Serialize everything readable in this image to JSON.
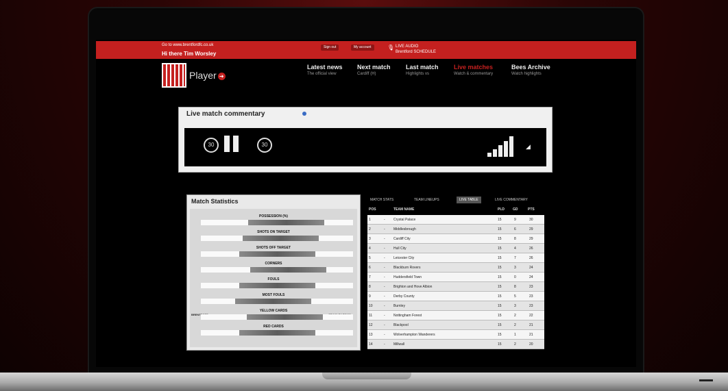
{
  "topbar": {
    "link_text": "Go to www.brentfordfc.co.uk",
    "greeting": "Hi there Tim Worsley",
    "sign_out": "Sign out",
    "my_account": "My account",
    "live_label": "LIVE AUDIO",
    "schedule_label": "Brentford SCHEDULE"
  },
  "header": {
    "brand": "Player",
    "nav": [
      {
        "title": "Latest news",
        "sub": "The official view"
      },
      {
        "title": "Next match",
        "sub": "Cardiff (H)"
      },
      {
        "title": "Last match",
        "sub": "Highlights vs"
      },
      {
        "title": "Live matches",
        "sub": "Watch & commentary"
      },
      {
        "title": "Bees Archive",
        "sub": "Watch highlights"
      }
    ]
  },
  "commentary": {
    "title": "Live match commentary",
    "skip_back": "30",
    "skip_forward": "30"
  },
  "stats": {
    "title": "Match Statistics",
    "home_team": "BRENTFORD",
    "away_team": "CRAWLEY TOWN",
    "rows": [
      {
        "label": "POSSESSION (%)",
        "home": 0.38,
        "away": 0.62
      },
      {
        "label": "SHOTS ON TARGET",
        "home": 0.45,
        "away": 0.55
      },
      {
        "label": "SHOTS OFF TARGET",
        "home": 0.5,
        "away": 0.5
      },
      {
        "label": "CORNERS",
        "home": 0.35,
        "away": 0.65
      },
      {
        "label": "FOULS",
        "home": 0.5,
        "away": 0.5
      },
      {
        "label": "MOST FOULS",
        "home": 0.55,
        "away": 0.45
      },
      {
        "label": "YELLOW CARDS",
        "home": 0.4,
        "away": 0.6
      },
      {
        "label": "RED CARDS",
        "home": 0.5,
        "away": 0.5
      }
    ]
  },
  "table": {
    "tabs": [
      "MATCH STATS",
      "TEAM LINEUPS",
      "LIVE TABLE",
      "LIVE COMMENTARY"
    ],
    "active_tab": 2,
    "columns": [
      "POS",
      "TEAM NAME",
      "PLD",
      "GD",
      "PTS"
    ],
    "rows": [
      {
        "pos": "1",
        "mv": "-",
        "team": "Crystal Palace",
        "pld": "15",
        "gd": "9",
        "pts": "30"
      },
      {
        "pos": "2",
        "mv": "-",
        "team": "Middlesbrough",
        "pld": "15",
        "gd": "6",
        "pts": "29"
      },
      {
        "pos": "3",
        "mv": "-",
        "team": "Cardiff City",
        "pld": "15",
        "gd": "8",
        "pts": "29"
      },
      {
        "pos": "4",
        "mv": "-",
        "team": "Hull City",
        "pld": "15",
        "gd": "4",
        "pts": "26"
      },
      {
        "pos": "5",
        "mv": "-",
        "team": "Leicester City",
        "pld": "15",
        "gd": "7",
        "pts": "26"
      },
      {
        "pos": "6",
        "mv": "-",
        "team": "Blackburn Rovers",
        "pld": "15",
        "gd": "3",
        "pts": "24"
      },
      {
        "pos": "7",
        "mv": "-",
        "team": "Huddersfield Town",
        "pld": "15",
        "gd": "0",
        "pts": "24"
      },
      {
        "pos": "8",
        "mv": "-",
        "team": "Brighton and Hove Albion",
        "pld": "15",
        "gd": "8",
        "pts": "23"
      },
      {
        "pos": "9",
        "mv": "-",
        "team": "Derby County",
        "pld": "15",
        "gd": "5",
        "pts": "23"
      },
      {
        "pos": "10",
        "mv": "-",
        "team": "Burnley",
        "pld": "15",
        "gd": "3",
        "pts": "23"
      },
      {
        "pos": "11",
        "mv": "-",
        "team": "Nottingham Forest",
        "pld": "15",
        "gd": "2",
        "pts": "22"
      },
      {
        "pos": "12",
        "mv": "-",
        "team": "Blackpool",
        "pld": "15",
        "gd": "2",
        "pts": "21"
      },
      {
        "pos": "13",
        "mv": "-",
        "team": "Wolverhampton Wanderers",
        "pld": "15",
        "gd": "1",
        "pts": "21"
      },
      {
        "pos": "14",
        "mv": "-",
        "team": "Millwall",
        "pld": "15",
        "gd": "2",
        "pts": "20"
      }
    ]
  },
  "colors": {
    "accent": "#c4201f",
    "background": "#000000"
  }
}
